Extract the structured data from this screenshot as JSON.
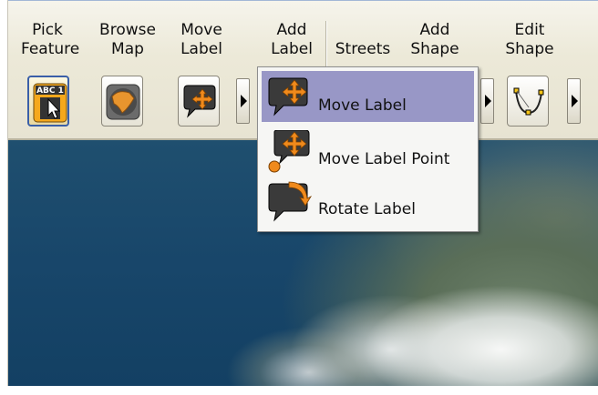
{
  "toolbar": {
    "tools": [
      {
        "label": "Pick\nFeature",
        "icon": "pick-feature-icon"
      },
      {
        "label": "Browse\nMap",
        "icon": "browse-map-icon"
      },
      {
        "label": "Move\nLabel",
        "icon": "move-label-icon"
      },
      {
        "label": "Add\nLabel",
        "icon": "add-label-icon"
      },
      {
        "label": "Streets",
        "icon": "streets-icon"
      },
      {
        "label": "Add\nShape",
        "icon": "add-shape-icon"
      },
      {
        "label": "Edit\nShape",
        "icon": "edit-shape-icon"
      }
    ]
  },
  "dropdown": {
    "items": [
      {
        "label": "Move Label",
        "icon": "move-label-icon",
        "selected": true
      },
      {
        "label": "Move Label Point",
        "icon": "move-label-point-icon",
        "selected": false
      },
      {
        "label": "Rotate Label",
        "icon": "rotate-label-icon",
        "selected": false
      }
    ]
  },
  "colors": {
    "toolbar_bg": "#ece9d8",
    "selection": "#9897c6",
    "accent_orange": "#f08a1c",
    "ocean": "#1a4a6d"
  }
}
